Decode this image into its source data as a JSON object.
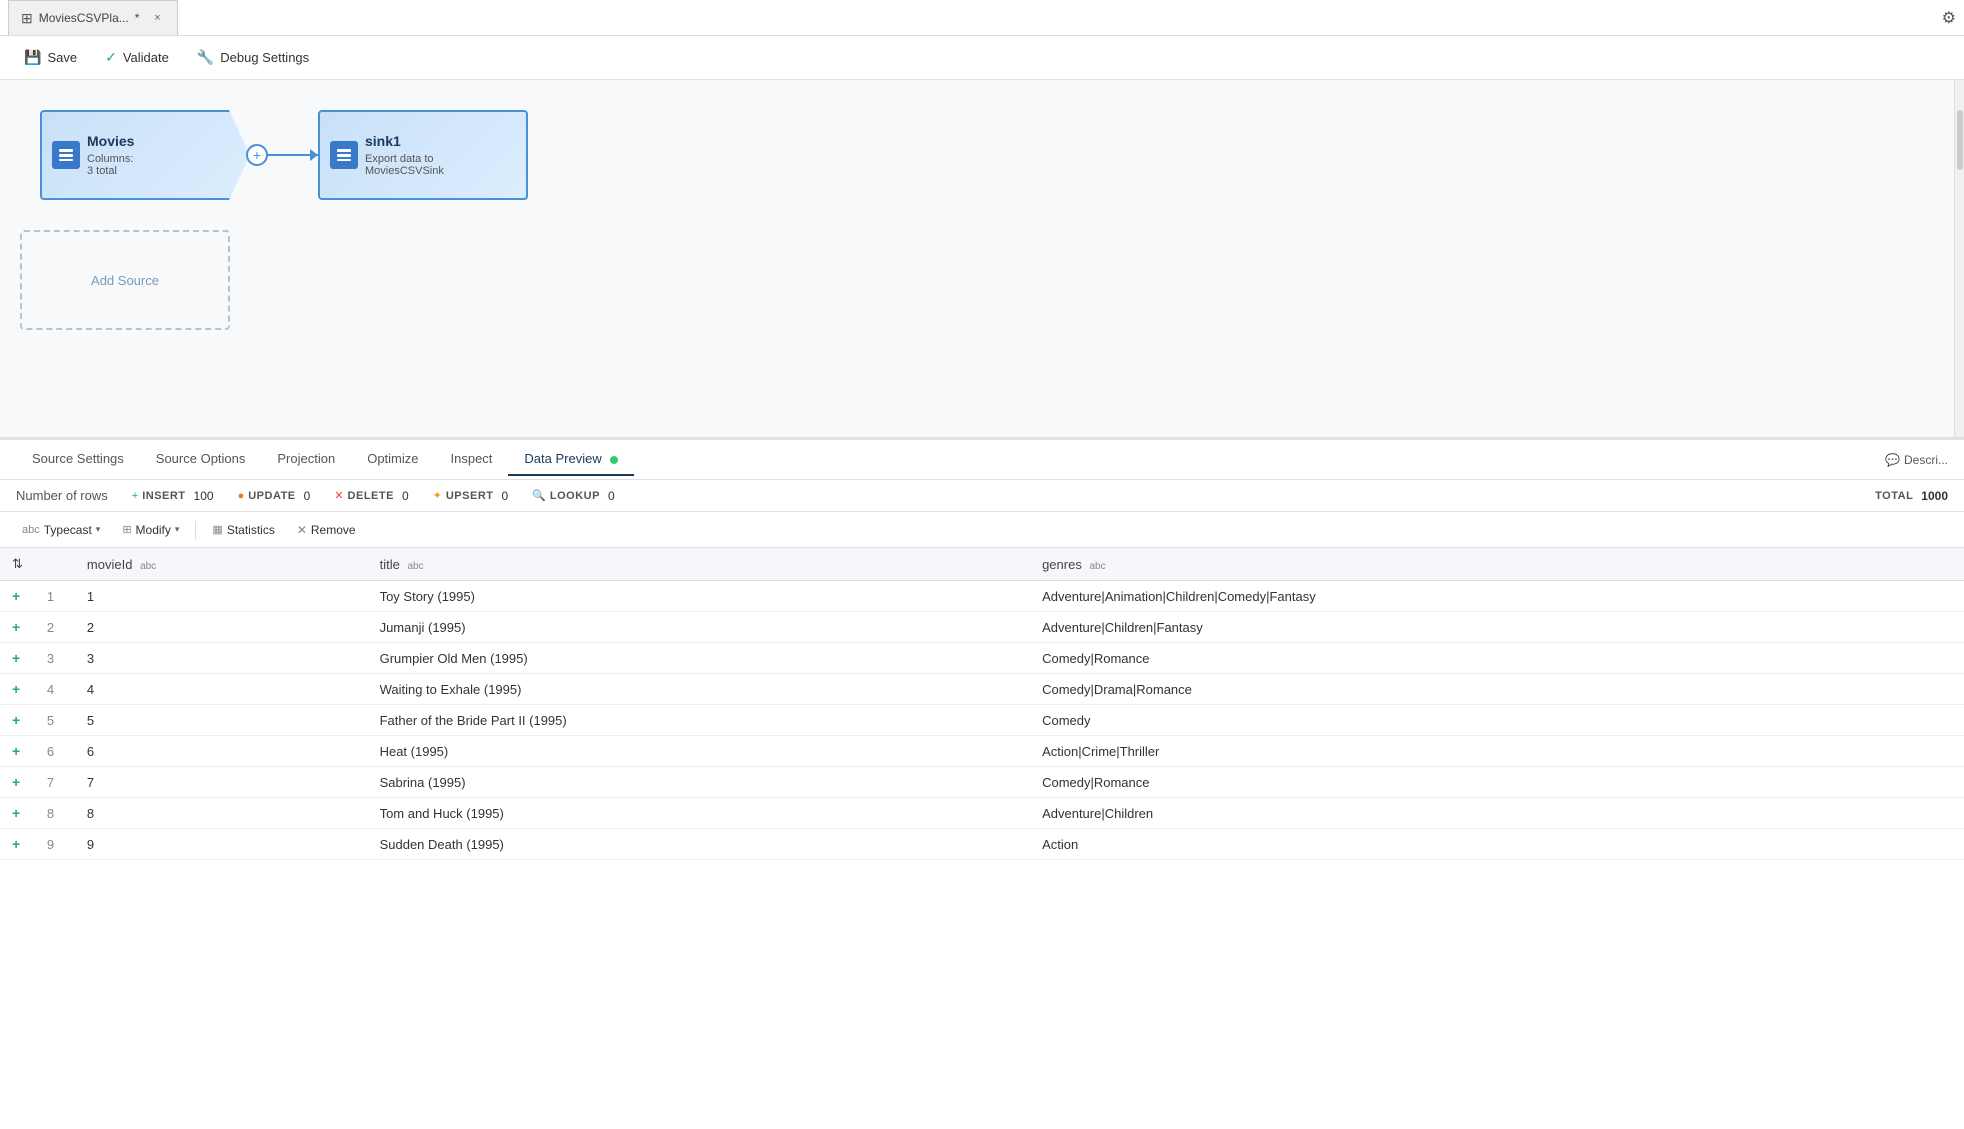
{
  "titleBar": {
    "tabName": "MoviesCSVPla...",
    "tabIcon": "⊞",
    "closeIcon": "×",
    "settingsIcon": "⚙"
  },
  "toolbar": {
    "saveLabel": "Save",
    "validateLabel": "Validate",
    "debugSettingsLabel": "Debug Settings",
    "saveIcon": "💾",
    "validateIcon": "✓",
    "debugIcon": "🔧"
  },
  "flowNodes": {
    "sourceNode": {
      "title": "Movies",
      "sub1": "Columns:",
      "sub2": "3 total",
      "icon": "🗄"
    },
    "sinkNode": {
      "title": "sink1",
      "sub": "Export data to MoviesCSVSink",
      "icon": "🗄"
    },
    "addSourceLabel": "Add Source"
  },
  "tabs": [
    {
      "id": "source-settings",
      "label": "Source Settings",
      "active": false
    },
    {
      "id": "source-options",
      "label": "Source Options",
      "active": false
    },
    {
      "id": "projection",
      "label": "Projection",
      "active": false
    },
    {
      "id": "optimize",
      "label": "Optimize",
      "active": false
    },
    {
      "id": "inspect",
      "label": "Inspect",
      "active": false
    },
    {
      "id": "data-preview",
      "label": "Data Preview",
      "active": true
    }
  ],
  "describeLabel": "Descri...",
  "statsBar": {
    "numberOfRowsLabel": "Number of rows",
    "insertLabel": "INSERT",
    "insertValue": "100",
    "updateLabel": "UPDATE",
    "updateValue": "0",
    "deleteLabel": "DELETE",
    "deleteValue": "0",
    "upsertLabel": "UPSERT",
    "upsertValue": "0",
    "lookupLabel": "LOOKUP",
    "lookupValue": "0",
    "totalLabel": "TOTAL",
    "totalValue": "1000"
  },
  "dataToolbar": {
    "typecastLabel": "Typecast",
    "modifyLabel": "Modify",
    "statisticsLabel": "Statistics",
    "removeLabel": "Remove",
    "typecastPrefix": "abc",
    "modifyPrefix": "⊞",
    "statisticsPrefix": "▦"
  },
  "tableColumns": [
    {
      "id": "sort",
      "label": "",
      "type": ""
    },
    {
      "id": "add",
      "label": "",
      "type": ""
    },
    {
      "id": "movieId",
      "label": "movieId",
      "type": "abc"
    },
    {
      "id": "title",
      "label": "title",
      "type": "abc"
    },
    {
      "id": "genres",
      "label": "genres",
      "type": "abc"
    }
  ],
  "tableRows": [
    {
      "add": "+",
      "num": "1",
      "movieId": "1",
      "title": "Toy Story (1995)",
      "genres": "Adventure|Animation|Children|Comedy|Fantasy"
    },
    {
      "add": "+",
      "num": "2",
      "movieId": "2",
      "title": "Jumanji (1995)",
      "genres": "Adventure|Children|Fantasy"
    },
    {
      "add": "+",
      "num": "3",
      "movieId": "3",
      "title": "Grumpier Old Men (1995)",
      "genres": "Comedy|Romance"
    },
    {
      "add": "+",
      "num": "4",
      "movieId": "4",
      "title": "Waiting to Exhale (1995)",
      "genres": "Comedy|Drama|Romance"
    },
    {
      "add": "+",
      "num": "5",
      "movieId": "5",
      "title": "Father of the Bride Part II (1995)",
      "genres": "Comedy"
    },
    {
      "add": "+",
      "num": "6",
      "movieId": "6",
      "title": "Heat (1995)",
      "genres": "Action|Crime|Thriller"
    },
    {
      "add": "+",
      "num": "7",
      "movieId": "7",
      "title": "Sabrina (1995)",
      "genres": "Comedy|Romance"
    },
    {
      "add": "+",
      "num": "8",
      "movieId": "8",
      "title": "Tom and Huck (1995)",
      "genres": "Adventure|Children"
    },
    {
      "add": "+",
      "num": "9",
      "movieId": "9",
      "title": "Sudden Death (1995)",
      "genres": "Action"
    }
  ]
}
